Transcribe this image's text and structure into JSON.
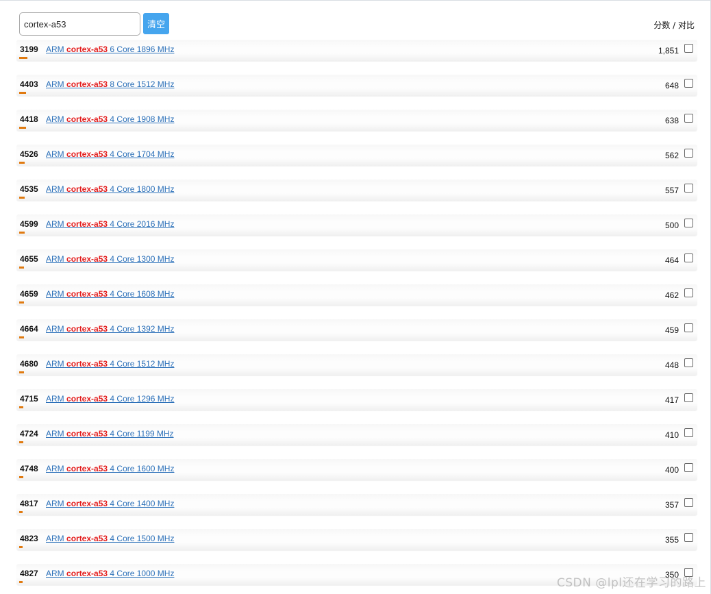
{
  "search": {
    "value": "cortex-a53"
  },
  "toolbar": {
    "clear_label": "清空"
  },
  "header": {
    "score_compare_label": "分数 / 对比"
  },
  "results": [
    {
      "rank": "3199",
      "vendor": "ARM",
      "model": "cortex-a53",
      "spec": "6 Core 1896 MHz",
      "score": "1,851",
      "score_value": 1851
    },
    {
      "rank": "4403",
      "vendor": "ARM",
      "model": "cortex-a53",
      "spec": "8 Core 1512 MHz",
      "score": "648",
      "score_value": 648
    },
    {
      "rank": "4418",
      "vendor": "ARM",
      "model": "cortex-a53",
      "spec": "4 Core 1908 MHz",
      "score": "638",
      "score_value": 638
    },
    {
      "rank": "4526",
      "vendor": "ARM",
      "model": "cortex-a53",
      "spec": "4 Core 1704 MHz",
      "score": "562",
      "score_value": 562
    },
    {
      "rank": "4535",
      "vendor": "ARM",
      "model": "cortex-a53",
      "spec": "4 Core 1800 MHz",
      "score": "557",
      "score_value": 557
    },
    {
      "rank": "4599",
      "vendor": "ARM",
      "model": "cortex-a53",
      "spec": "4 Core 2016 MHz",
      "score": "500",
      "score_value": 500
    },
    {
      "rank": "4655",
      "vendor": "ARM",
      "model": "cortex-a53",
      "spec": "4 Core 1300 MHz",
      "score": "464",
      "score_value": 464
    },
    {
      "rank": "4659",
      "vendor": "ARM",
      "model": "cortex-a53",
      "spec": "4 Core 1608 MHz",
      "score": "462",
      "score_value": 462
    },
    {
      "rank": "4664",
      "vendor": "ARM",
      "model": "cortex-a53",
      "spec": "4 Core 1392 MHz",
      "score": "459",
      "score_value": 459
    },
    {
      "rank": "4680",
      "vendor": "ARM",
      "model": "cortex-a53",
      "spec": "4 Core 1512 MHz",
      "score": "448",
      "score_value": 448
    },
    {
      "rank": "4715",
      "vendor": "ARM",
      "model": "cortex-a53",
      "spec": "4 Core 1296 MHz",
      "score": "417",
      "score_value": 417
    },
    {
      "rank": "4724",
      "vendor": "ARM",
      "model": "cortex-a53",
      "spec": "4 Core 1199 MHz",
      "score": "410",
      "score_value": 410
    },
    {
      "rank": "4748",
      "vendor": "ARM",
      "model": "cortex-a53",
      "spec": "4 Core 1600 MHz",
      "score": "400",
      "score_value": 400
    },
    {
      "rank": "4817",
      "vendor": "ARM",
      "model": "cortex-a53",
      "spec": "4 Core 1400 MHz",
      "score": "357",
      "score_value": 357
    },
    {
      "rank": "4823",
      "vendor": "ARM",
      "model": "cortex-a53",
      "spec": "4 Core 1500 MHz",
      "score": "355",
      "score_value": 355
    },
    {
      "rank": "4827",
      "vendor": "ARM",
      "model": "cortex-a53",
      "spec": "4 Core 1000 MHz",
      "score": "350",
      "score_value": 350
    }
  ],
  "colors": {
    "accent_button": "#45a5ee",
    "score_bar": "#e07a10",
    "link": "#2a6fb8",
    "highlight": "#e31b1b"
  },
  "watermark": {
    "text": "CSDN @lpl还在学习的路上"
  }
}
